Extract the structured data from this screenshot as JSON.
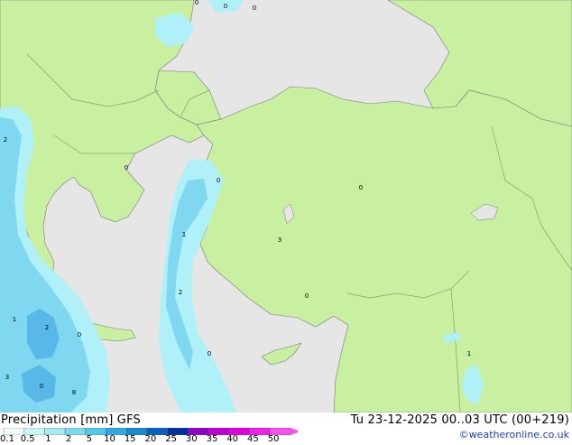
{
  "header": {
    "title": "Precipitation [mm]  GFS",
    "valid_time": "Tu 23-12-2025 00..03 UTC (00+219)"
  },
  "credit": "©weatheronline.co.uk",
  "legend": {
    "ticks": [
      "0.1",
      "0.5",
      "1",
      "2",
      "5",
      "10",
      "15",
      "20",
      "25",
      "30",
      "35",
      "40",
      "45",
      "50"
    ],
    "colors": [
      "#f0fcfc",
      "#c8f4f4",
      "#a0ecf0",
      "#78dcec",
      "#50c8e8",
      "#30a8e0",
      "#1888d0",
      "#0860c0",
      "#0030a0",
      "#9000c8",
      "#c000d8",
      "#e000e0",
      "#f020e8",
      "#f850f0"
    ]
  },
  "map": {
    "colors": {
      "sea": "#e6e6e6",
      "land": "#c8f0a0",
      "border": "#8aa070",
      "coast": "#7a7a7a",
      "precip_light": "#b0f0f8",
      "precip_mid": "#80d8f0",
      "precip_heavy": "#58b8e8"
    },
    "value_labels": [
      "0",
      "0",
      "0",
      "0",
      "2",
      "0",
      "1",
      "1",
      "2",
      "2",
      "0",
      "3",
      "0",
      "8",
      "0",
      "1",
      "3",
      "0",
      "0"
    ]
  }
}
